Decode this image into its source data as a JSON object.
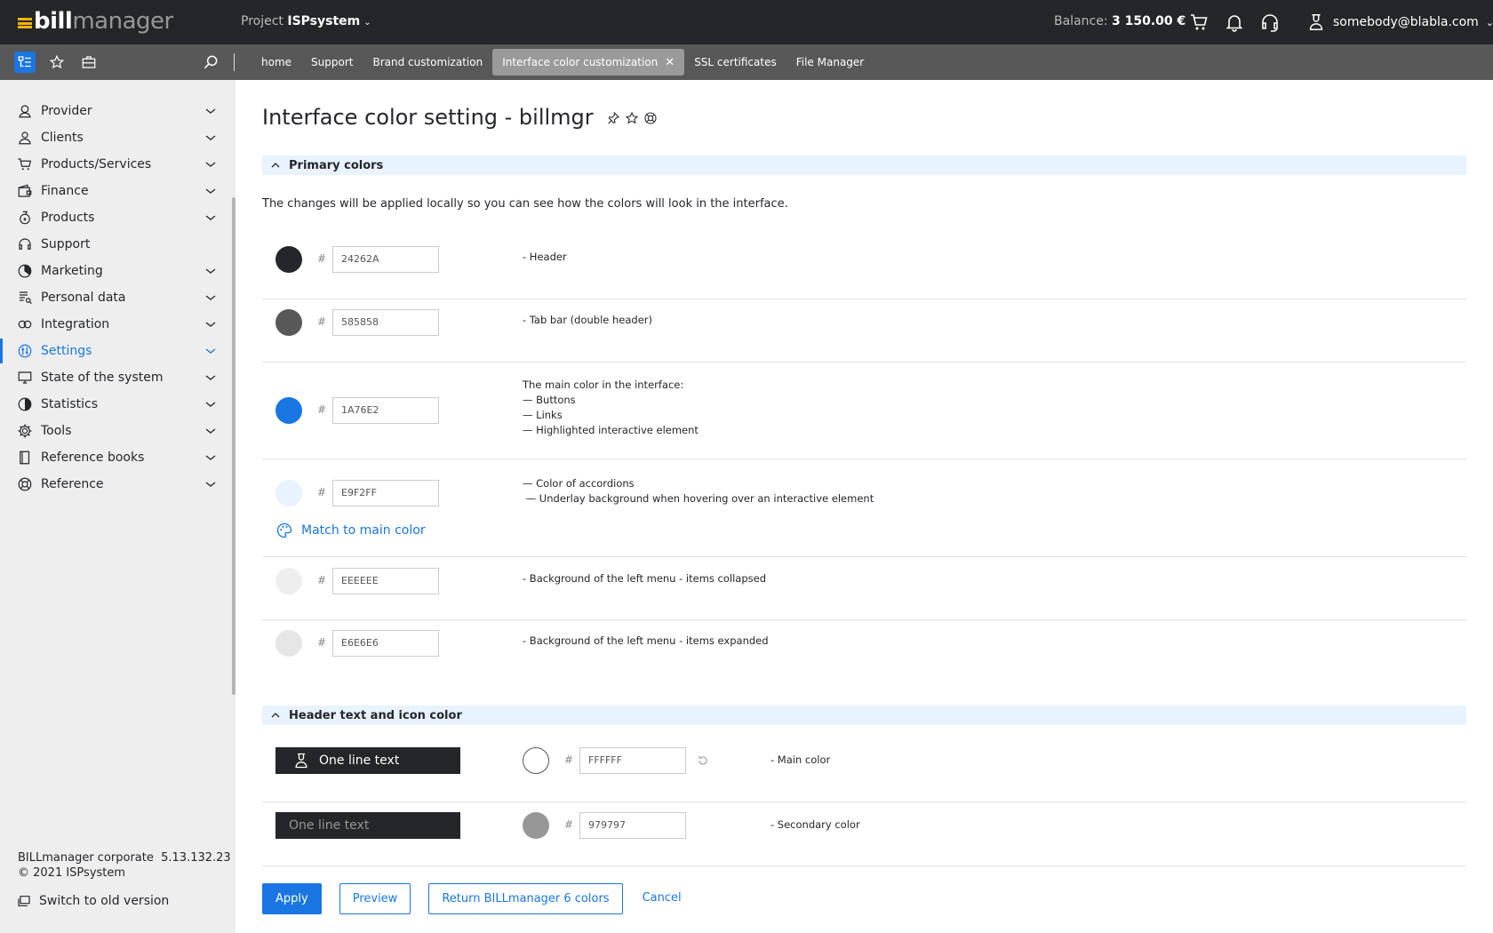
{
  "header": {
    "logo_part1": "bill",
    "logo_part2": "manager",
    "project_label": "Project",
    "project_name": "ISPsystem",
    "balance_label": "Balance:",
    "balance_value": "3 150.00 €",
    "user_email": "somebody@blabla.com"
  },
  "tabs": [
    {
      "label": "home"
    },
    {
      "label": "Support"
    },
    {
      "label": "Brand customization"
    },
    {
      "label": "Interface color customization",
      "active": true
    },
    {
      "label": "SSL certificates"
    },
    {
      "label": "File Manager"
    }
  ],
  "sidebar": {
    "items": [
      {
        "label": "Provider",
        "icon": "provider-icon",
        "expandable": true
      },
      {
        "label": "Clients",
        "icon": "clients-icon",
        "expandable": true
      },
      {
        "label": "Products/Services",
        "icon": "cart-icon",
        "expandable": true
      },
      {
        "label": "Finance",
        "icon": "finance-icon",
        "expandable": true
      },
      {
        "label": "Products",
        "icon": "products-icon",
        "expandable": true
      },
      {
        "label": "Support",
        "icon": "headset-icon",
        "expandable": false
      },
      {
        "label": "Marketing",
        "icon": "marketing-icon",
        "expandable": true
      },
      {
        "label": "Personal data",
        "icon": "personal-data-icon",
        "expandable": true
      },
      {
        "label": "Integration",
        "icon": "integration-icon",
        "expandable": true
      },
      {
        "label": "Settings",
        "icon": "settings-icon",
        "expandable": true,
        "active": true
      },
      {
        "label": "State of the system",
        "icon": "monitor-icon",
        "expandable": true
      },
      {
        "label": "Statistics",
        "icon": "statistics-icon",
        "expandable": true
      },
      {
        "label": "Tools",
        "icon": "gear-icon",
        "expandable": true
      },
      {
        "label": "Reference books",
        "icon": "book-icon",
        "expandable": true
      },
      {
        "label": "Reference",
        "icon": "lifebuoy-icon",
        "expandable": true
      }
    ],
    "footer_product": "BILLmanager corporate",
    "footer_version": "5.13.132.23",
    "footer_copyright": "© 2021 ISPsystem",
    "switch_label": "Switch to old version"
  },
  "page": {
    "title": "Interface color setting - billmgr",
    "section_primary": "Primary colors",
    "intro": "The changes will be applied locally so you can see how the colors will look in the interface.",
    "hash": "#",
    "primary_rows": [
      {
        "hex": "24262A",
        "color": "#24262A",
        "desc": [
          "- Header"
        ]
      },
      {
        "hex": "585858",
        "color": "#585858",
        "desc": [
          "- Tab bar (double header)"
        ]
      },
      {
        "hex": "1A76E2",
        "color": "#1A76E2",
        "desc": [
          "The main color in the interface:",
          "— Buttons",
          "— Links",
          "— Highlighted interactive element"
        ]
      },
      {
        "hex": "E9F2FF",
        "color": "#E9F2FF",
        "desc": [
          "— Color of accordions",
          " — Underlay background when hovering over an interactive element"
        ]
      },
      {
        "hex": "EEEEEE",
        "color": "#EEEEEE",
        "desc": [
          "- Background of the left menu - items collapsed"
        ]
      },
      {
        "hex": "E6E6E6",
        "color": "#E6E6E6",
        "desc": [
          "- Background of the left menu - items expanded"
        ]
      }
    ],
    "match_label": "Match to main color",
    "section_header_text": "Header text and icon color",
    "header_rows": [
      {
        "sample": "One line text",
        "hex": "FFFFFF",
        "color": "#FFFFFF",
        "desc": "- Main color",
        "sample_color": "#FFFFFF"
      },
      {
        "sample": "One line text",
        "hex": "979797",
        "color": "#979797",
        "desc": "- Secondary color",
        "sample_color": "#979797"
      }
    ],
    "buttons": {
      "apply": "Apply",
      "preview": "Preview",
      "return": "Return BILLmanager 6 colors",
      "cancel": "Cancel"
    }
  },
  "colors": {
    "accent": "#1A76E2",
    "header_bg": "#24262A",
    "tabbar_bg": "#585858",
    "sidebar_bg": "#EEEEEE",
    "accordion_bg": "#E9F2FF"
  }
}
